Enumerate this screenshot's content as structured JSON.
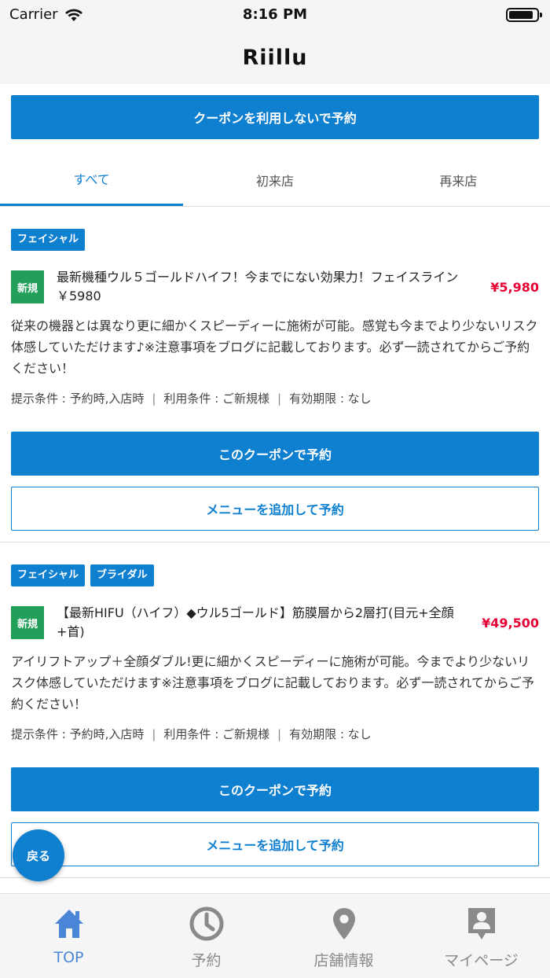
{
  "status": {
    "carrier": "Carrier",
    "time": "8:16 PM"
  },
  "nav": {
    "title": "Riillu"
  },
  "no_coupon_button": "クーポンを利用しないで予約",
  "tabs": [
    {
      "label": "すべて"
    },
    {
      "label": "初来店"
    },
    {
      "label": "再来店"
    }
  ],
  "coupons": [
    {
      "tags": [
        "フェイシャル"
      ],
      "badge": "新規",
      "title": "最新機種ウル５ゴールドハイフ！今までにない効果力！フェイスライン￥5980",
      "price": "¥5,980",
      "description": "従来の機器とは異なり更に細かくスピーディーに施術が可能。感覚も今までより少ないリスク体感していただけます♪※注意事項をブログに記載しております。必ず一読されてからご予約ください！",
      "cond_present": "提示条件 : 予約時,入店時",
      "cond_use": "利用条件 : ご新規様",
      "cond_expiry": "有効期限 : なし",
      "reserve_label": "このクーポンで予約",
      "add_menu_label": "メニューを追加して予約"
    },
    {
      "tags": [
        "フェイシャル",
        "ブライダル"
      ],
      "badge": "新規",
      "title": "【最新HIFU（ハイフ）◆ウル5ゴールド】筋膜層から2層打(目元+全顔+首)",
      "price": "¥49,500",
      "description": "アイリフトアップ＋全顔ダブル!更に細かくスピーディーに施術が可能。今までより少ないリスク体感していただけます※注意事項をブログに記載しております。必ず一読されてからご予約ください！",
      "cond_present": "提示条件 : 予約時,入店時",
      "cond_use": "利用条件 : ご新規様",
      "cond_expiry": "有効期限 : なし",
      "reserve_label": "このクーポンで予約",
      "add_menu_label": "メニューを追加して予約"
    }
  ],
  "back_button": "戻る",
  "tab_bar": [
    {
      "label": "TOP",
      "icon": "home-icon",
      "active": true
    },
    {
      "label": "予約",
      "icon": "clock-icon"
    },
    {
      "label": "店舗情報",
      "icon": "map-pin-icon"
    },
    {
      "label": "マイページ",
      "icon": "user-badge-icon"
    }
  ],
  "colors": {
    "primary": "#0f7fd0",
    "price": "#e60033",
    "badge_new": "#22a05a",
    "tab_active": "#4a86d8"
  }
}
